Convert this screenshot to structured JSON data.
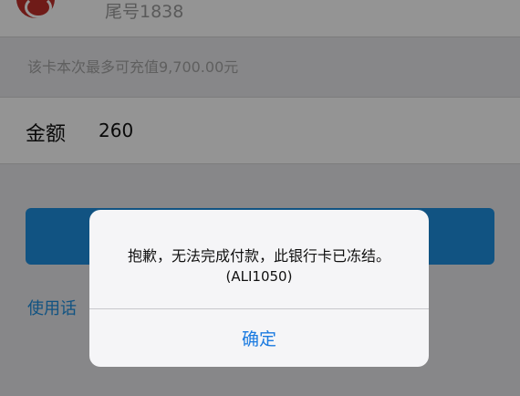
{
  "card": {
    "tail_label": "尾号1838",
    "logo_icon": "bank-logo-icon"
  },
  "hint": "该卡本次最多可充值9,700.00元",
  "amount": {
    "label": "金额",
    "value": "260"
  },
  "service_link": "使用话",
  "dialog": {
    "message": "抱歉，无法完成付款，此银行卡已冻结。",
    "code": "(ALI1050)",
    "ok_label": "确定"
  },
  "colors": {
    "accent": "#1e8fe0",
    "bank_red": "#c0302a",
    "overlay": "rgba(0,0,0,0.42)"
  }
}
